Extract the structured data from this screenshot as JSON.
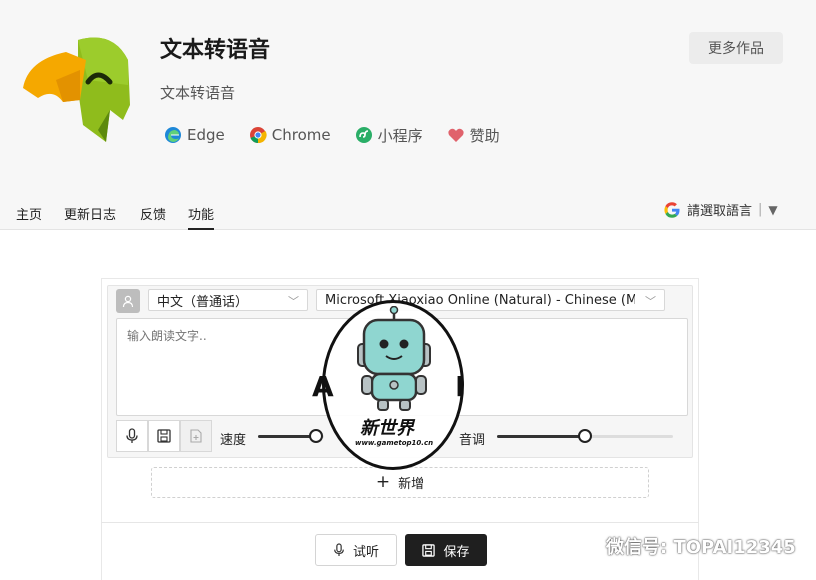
{
  "app": {
    "title": "文本转语音",
    "subtitle": "文本转语音",
    "more_button": "更多作品"
  },
  "platforms": [
    {
      "label": "Edge",
      "icon": "edge-icon"
    },
    {
      "label": "Chrome",
      "icon": "chrome-icon"
    },
    {
      "label": "小程序",
      "icon": "mini-program-icon"
    },
    {
      "label": "赞助",
      "icon": "heart-icon"
    }
  ],
  "nav": {
    "items": [
      {
        "label": "主页"
      },
      {
        "label": "更新日志"
      },
      {
        "label": "反馈"
      },
      {
        "label": "功能"
      }
    ],
    "active": "功能"
  },
  "translate": {
    "label": "請選取語言",
    "arrow": "▼"
  },
  "editor": {
    "language": "中文（普通话）",
    "voice": "Microsoft Xiaoxiao Online (Natural) - Chinese (M...",
    "placeholder": "输入朗读文字..",
    "speed_label": "速度",
    "speed_value": 0.88,
    "pitch_label": "音调",
    "pitch_value": 0.5
  },
  "actions": {
    "add": "新增",
    "listen": "试听",
    "save": "保存"
  },
  "watermark": {
    "left": "A",
    "right": "I",
    "name": "新世界",
    "url": "www.gametop10.cn"
  },
  "wechat_watermark": "微信号: TOPAI12345",
  "colors": {
    "header_bg": "#f7f7f7",
    "save_bg": "#1f1f1f",
    "logo_green": "#8fbc1c",
    "logo_orange": "#f5a800"
  }
}
